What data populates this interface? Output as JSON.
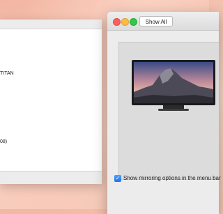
{
  "left_window": {
    "lines": [
      "TITAN",
      "08)"
    ]
  },
  "prefs_window": {
    "show_all_label": "Show All",
    "mirroring": {
      "label": "Show mirroring options in the menu bar",
      "checked": true
    }
  }
}
